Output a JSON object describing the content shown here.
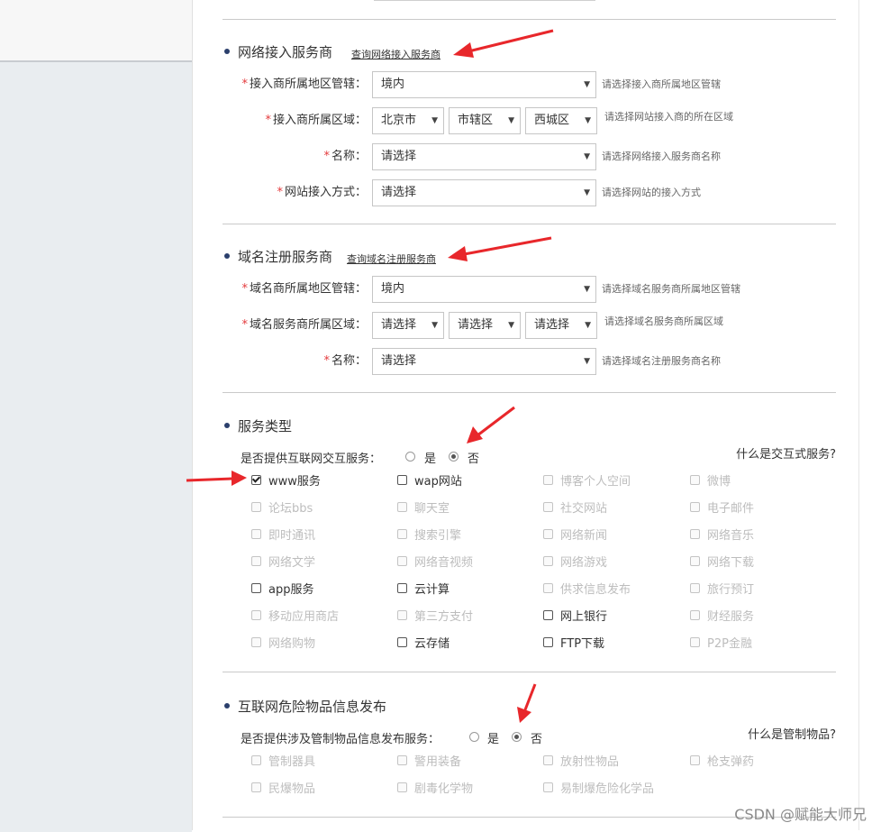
{
  "isp_section": {
    "title": "网络接入服务商",
    "query_link": "查询网络接入服务商",
    "fields": [
      {
        "label": "接入商所属地区管辖：",
        "selects": [
          "境内"
        ],
        "hint": "请选择接入商所属地区管辖"
      },
      {
        "label": "接入商所属区域：",
        "selects": [
          "北京市",
          "市辖区",
          "西城区"
        ],
        "hint": "请选择网站接入商的所在区域"
      },
      {
        "label": "名称：",
        "selects": [
          "请选择"
        ],
        "hint": "请选择网络接入服务商名称"
      },
      {
        "label": "网站接入方式：",
        "selects": [
          "请选择"
        ],
        "hint": "请选择网站的接入方式"
      }
    ]
  },
  "registrar_section": {
    "title": "域名注册服务商",
    "query_link": "查询域名注册服务商",
    "fields": [
      {
        "label": "域名商所属地区管辖：",
        "selects": [
          "境内"
        ],
        "hint": "请选择域名服务商所属地区管辖"
      },
      {
        "label": "域名服务商所属区域：",
        "selects": [
          "请选择",
          "请选择",
          "请选择"
        ],
        "hint": "请选择域名服务商所属区域"
      },
      {
        "label": "名称：",
        "selects": [
          "请选择"
        ],
        "hint": "请选择域名注册服务商名称"
      }
    ]
  },
  "service_type_section": {
    "title": "服务类型",
    "question": "是否提供互联网交互服务：",
    "options": [
      "是",
      "否"
    ],
    "selected": "否",
    "help_link": "什么是交互式服务?",
    "checkboxes": [
      [
        "www服务",
        "wap网站",
        "博客个人空间",
        "微博"
      ],
      [
        "论坛bbs",
        "聊天室",
        "社交网站",
        "电子邮件"
      ],
      [
        "即时通讯",
        "搜索引擎",
        "网络新闻",
        "网络音乐"
      ],
      [
        "网络文学",
        "网络音视频",
        "网络游戏",
        "网络下载"
      ],
      [
        "app服务",
        "云计算",
        "供求信息发布",
        "旅行预订"
      ],
      [
        "移动应用商店",
        "第三方支付",
        "网上银行",
        "财经服务"
      ],
      [
        "网络购物",
        "云存储",
        "FTP下载",
        "P2P金融"
      ]
    ],
    "enabled": [
      "www服务",
      "wap网站",
      "app服务",
      "云计算",
      "网上银行",
      "云存储",
      "FTP下载"
    ],
    "checked": [
      "www服务"
    ]
  },
  "dangerous_goods_section": {
    "title": "互联网危险物品信息发布",
    "question": "是否提供涉及管制物品信息发布服务：",
    "options": [
      "是",
      "否"
    ],
    "selected": "否",
    "help_link": "什么是管制物品?",
    "checkboxes": [
      [
        "管制器具",
        "警用装备",
        "放射性物品",
        "枪支弹药"
      ],
      [
        "民爆物品",
        "剧毒化学物",
        "易制爆危险化学品"
      ]
    ]
  },
  "watermark": "CSDN @赋能大师兄",
  "colors": {
    "required_star": "#e4393c",
    "annotation_arrow": "#e8272b",
    "bullet": "#2b3f6c",
    "disabled_text": "#bdbdbd"
  },
  "icons": [
    "required-star-icon",
    "select-arrow-icon",
    "bullet-dot-icon",
    "red-annotation-arrow-icon",
    "checkbox-check-icon"
  ]
}
